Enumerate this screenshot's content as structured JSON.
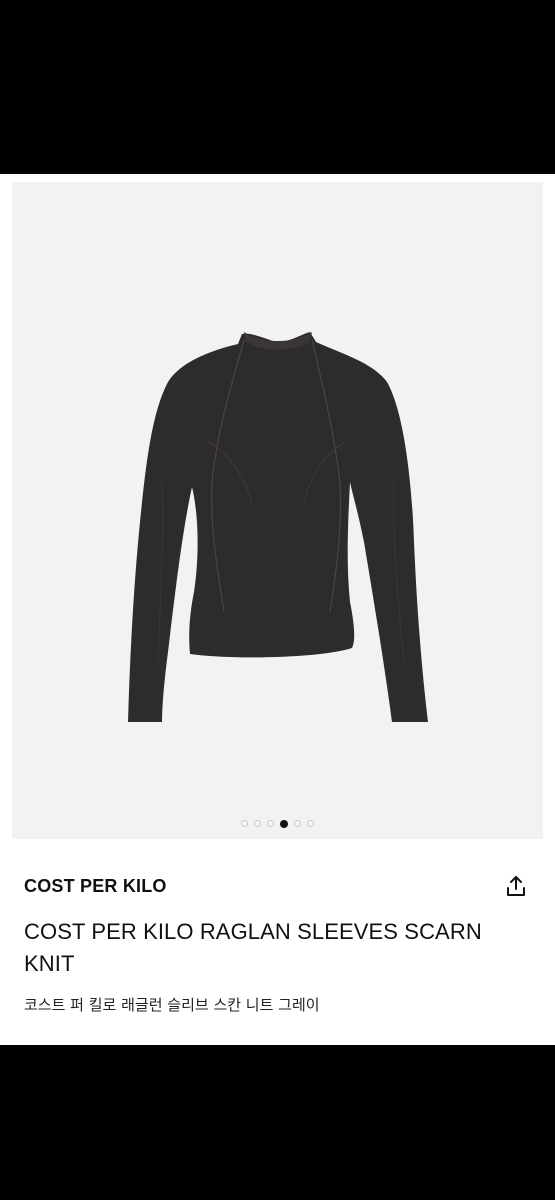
{
  "product": {
    "brand": "COST PER KILO",
    "title": "COST PER KILO RAGLAN SLEEVES SCARN KNIT",
    "subtitle": "코스트 퍼 킬로 래글런 슬리브 스칸 니트 그레이",
    "share_icon": "share-icon"
  },
  "gallery": {
    "total_images": 6,
    "active_index": 3
  },
  "colors": {
    "garment": "#2e2b2b",
    "background": "#f2f2f2",
    "dot_active": "#111111"
  }
}
